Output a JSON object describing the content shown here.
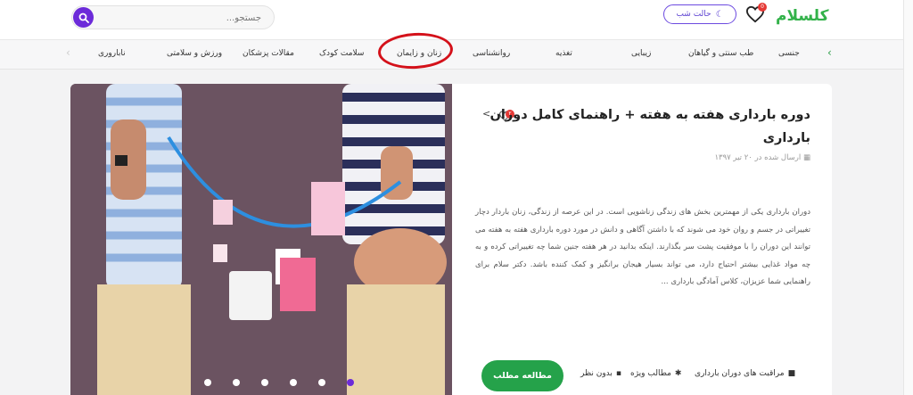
{
  "header": {
    "logo_text": "کلسلام",
    "night_mode_label": "حالت شب",
    "likes_count": "0",
    "search": {
      "placeholder": "جستجو..."
    }
  },
  "nav": {
    "items": [
      {
        "label": "جنسی"
      },
      {
        "label": "طب سنتی و گیاهان"
      },
      {
        "label": "زیبایی"
      },
      {
        "label": "تغذیه"
      },
      {
        "label": "روانشناسی"
      },
      {
        "label": "زنان و زایمان"
      },
      {
        "label": "سلامت کودک"
      },
      {
        "label": "مقالات پزشکان"
      },
      {
        "label": "ورزش و سلامتی"
      },
      {
        "label": "ناباروری"
      }
    ]
  },
  "article": {
    "title": "دوره بارداری هفته به هفته + راهنمای کامل دوران بارداری",
    "date": "ارسال شده در ۲۰ تیر ۱۳۹۷",
    "likes_badge": "۲",
    "excerpt": "دوران بارداری یکی از مهمترین بخش های زندگی زناشویی است. در این عرصه از زندگی، زنان باردار دچار تغییراتی در جسم و روان خود می شوند که با داشتن آگاهی و دانش در مورد دوره بارداری هفته به هفته می توانند این دوران را با موفقیت پشت سر بگذارند. اینکه بدانید در هر هفته جنین شما چه تغییراتی کرده و به چه مواد غذایی بیشتر احتیاج دارد، می تواند بسیار هیجان برانگیز و کمک کننده باشد. دکتر سلام برای راهنمایی شما عزیزان، کلاس آمادگی بارداری ...",
    "category": "مراقبت های دوران بارداری",
    "special": "مطالب ویژه",
    "comments": "بدون نظر",
    "read_button": "مطالعه مطلب"
  },
  "colors": {
    "accent_purple": "#6c2bd9",
    "brand_green": "#33b24a",
    "button_green": "#25a24a",
    "badge_red": "#e53935",
    "highlight_circle": "#d4111a"
  }
}
